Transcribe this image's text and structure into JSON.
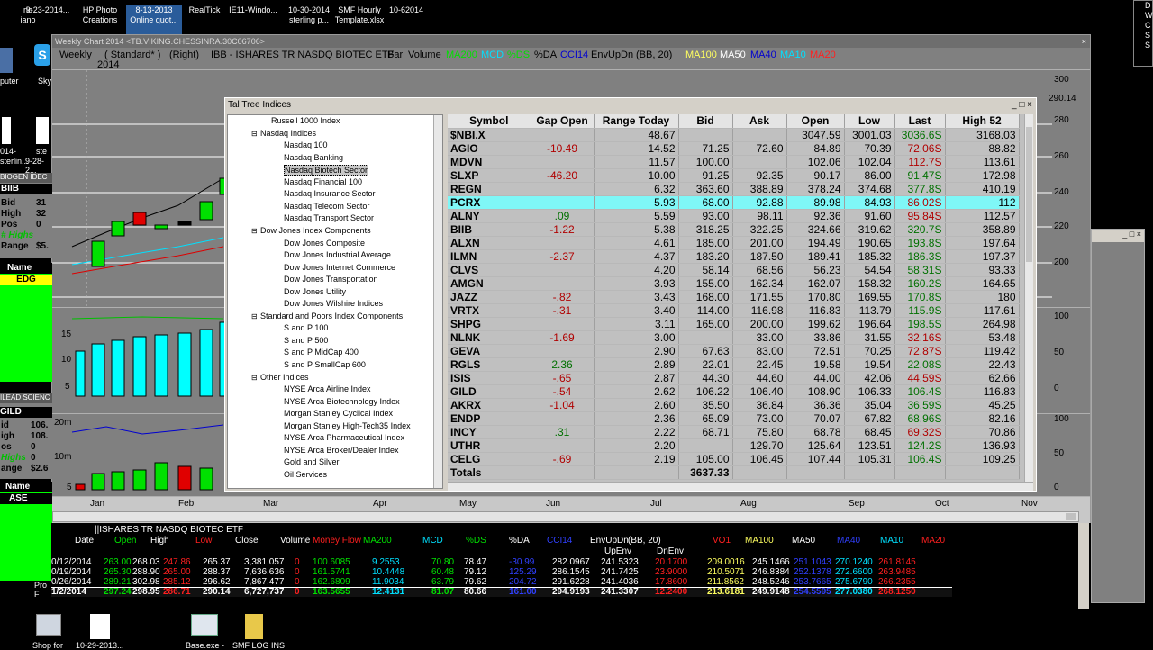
{
  "desktop_icons": [
    {
      "label1": "rio",
      "label2": "iano"
    },
    {
      "label1": "9-23-2014...",
      "label2": ""
    },
    {
      "label1": "HP Photo",
      "label2": "Creations"
    },
    {
      "label1": "8-13-2013",
      "label2": "Online quot..."
    },
    {
      "label1": "RealTick",
      "label2": ""
    },
    {
      "label1": "IE11-Windo...",
      "label2": ""
    },
    {
      "label1": "10-30-2014",
      "label2": "sterling p..."
    },
    {
      "label1": "SMF Hourly",
      "label2": "Template.xlsx"
    },
    {
      "label1": "10-62014",
      "label2": ""
    }
  ],
  "bottom_icons": [
    "Shop for",
    "10-29-2013...",
    "Base.exe -",
    "SMF LOG INS"
  ],
  "left_icons": [
    "puter",
    "Sky",
    "014-",
    "sterlin...",
    "ste",
    "9-28-2..."
  ],
  "chart_window": {
    "title": "Weekly Chart 2014",
    "title_path": "<TB.VIKING.CHESSINRA.30C06706>",
    "header": {
      "period": "Weekly",
      "style": "( Standard* )",
      "year": "2014",
      "side": "(Right)",
      "symbol": "IBB - ISHARES TR NASDQ BIOTEC ETF",
      "type": "Bar",
      "volume": "Volume",
      "ind1": "MA200",
      "ind2": "MCD",
      "ind3": "%DS",
      "ind4": "%DA",
      "ind5": "CCI14",
      "ind6": "EnvUpDn",
      "ind7": "(BB, 20)",
      "ind8": "MA100",
      "ind9": "MA50",
      "ind10": "MA40",
      "ind11": "MA10",
      "ind12": "MA20"
    },
    "price_axis": [
      "300",
      "290.14",
      "280",
      "260",
      "240",
      "220",
      "200"
    ],
    "vol_axis_left": [
      "15",
      "10",
      "5"
    ],
    "mcd_axis_left": [
      "20m",
      "10m",
      "5"
    ],
    "mid_axis": [
      "100",
      "50",
      "0"
    ],
    "bot_axis": [
      "100",
      "50",
      "0"
    ],
    "months": [
      "Jan",
      "Feb",
      "Mar",
      "Apr",
      "May",
      "Jun",
      "Jul",
      "Aug",
      "Sep",
      "Oct",
      "Nov"
    ],
    "left_panels": {
      "biib_label": "BIOGEN IDEC",
      "biib_sym": "BIIB",
      "bid": "Bid",
      "high": "High",
      "pos": "Pos",
      "highs": "# Highs",
      "range": "Range",
      "val1": "31",
      "val2": "32",
      "val3": "0",
      "val4": "$5.",
      "name1": "Name",
      "edg": "EDG",
      "gild_label": "ILEAD SCIENC",
      "gild_sym": "GILD",
      "id": "id",
      "igh": "igh",
      "os": "os",
      "highs2": "Highs",
      "range2": "ange",
      "gv1": "106.",
      "gv2": "108.",
      "gv3": "0",
      "gv4": "0",
      "gv5": "$2.6",
      "name2": "Name",
      "ase": "ASE",
      "pro": "Pro F"
    }
  },
  "tal": {
    "title": "Tal Tree Indices",
    "tree": [
      {
        "t": "Russell 1000 Index",
        "lvl": 1
      },
      {
        "t": "Nasdaq Indices",
        "lvl": 0
      },
      {
        "t": "Nasdaq 100",
        "lvl": 2
      },
      {
        "t": "Nasdaq Banking",
        "lvl": 2
      },
      {
        "t": "Nasdaq Biotech Sector",
        "lvl": 2
      },
      {
        "t": "Nasdaq Financial 100",
        "lvl": 2
      },
      {
        "t": "Nasdaq Insurance Sector",
        "lvl": 2
      },
      {
        "t": "Nasdaq Telecom Sector",
        "lvl": 2
      },
      {
        "t": "Nasdaq Transport Sector",
        "lvl": 2
      },
      {
        "t": "Dow Jones Index Components",
        "lvl": 0
      },
      {
        "t": "Dow Jones Composite",
        "lvl": 2
      },
      {
        "t": "Dow Jones Industrial Average",
        "lvl": 2
      },
      {
        "t": "Dow Jones Internet Commerce",
        "lvl": 2
      },
      {
        "t": "Dow Jones Transportation",
        "lvl": 2
      },
      {
        "t": "Dow Jones Utility",
        "lvl": 2
      },
      {
        "t": "Dow Jones Wilshire Indices",
        "lvl": 2
      },
      {
        "t": "Standard and Poors Index Components",
        "lvl": 0
      },
      {
        "t": "S and P 100",
        "lvl": 2
      },
      {
        "t": "S and P 500",
        "lvl": 2
      },
      {
        "t": "S and P MidCap 400",
        "lvl": 2
      },
      {
        "t": "S and P SmallCap 600",
        "lvl": 2
      },
      {
        "t": "Other Indices",
        "lvl": 0
      },
      {
        "t": "NYSE Arca Airline Index",
        "lvl": 2
      },
      {
        "t": "NYSE Arca Biotechnology Index",
        "lvl": 2
      },
      {
        "t": "Morgan Stanley Cyclical Index",
        "lvl": 2
      },
      {
        "t": "Morgan Stanley High-Tech35 Index",
        "lvl": 2
      },
      {
        "t": "NYSE Arca Pharmaceutical Index",
        "lvl": 2
      },
      {
        "t": "NYSE Arca Broker/Dealer Index",
        "lvl": 2
      },
      {
        "t": "Gold and Silver",
        "lvl": 2
      },
      {
        "t": "Oil Services",
        "lvl": 2
      }
    ],
    "columns": [
      "Symbol",
      "Gap Open",
      "Range Today",
      "Bid",
      "Ask",
      "Open",
      "Low",
      "Last",
      "High 52"
    ],
    "rows": [
      [
        "$NBI.X",
        "",
        "48.67",
        "",
        "",
        "3047.59",
        "3001.03",
        "3036.6S",
        "3168.03"
      ],
      [
        "AGIO",
        "-10.49",
        "14.52",
        "71.25",
        "72.60",
        "84.89",
        "70.39",
        "72.06S",
        "88.82"
      ],
      [
        "MDVN",
        "",
        "11.57",
        "100.00",
        "",
        "102.06",
        "102.04",
        "112.7S",
        "113.61"
      ],
      [
        "SLXP",
        "-46.20",
        "10.00",
        "91.25",
        "92.35",
        "90.17",
        "86.00",
        "91.47S",
        "172.98"
      ],
      [
        "REGN",
        "",
        "6.32",
        "363.60",
        "388.89",
        "378.24",
        "374.68",
        "377.8S",
        "410.19"
      ],
      [
        "PCRX",
        "",
        "5.93",
        "68.00",
        "92.88",
        "89.98",
        "84.93",
        "86.02S",
        "112"
      ],
      [
        "ALNY",
        ".09",
        "5.59",
        "93.00",
        "98.11",
        "92.36",
        "91.60",
        "95.84S",
        "112.57"
      ],
      [
        "BIIB",
        "-1.22",
        "5.38",
        "318.25",
        "322.25",
        "324.66",
        "319.62",
        "320.7S",
        "358.89"
      ],
      [
        "ALXN",
        "",
        "4.61",
        "185.00",
        "201.00",
        "194.49",
        "190.65",
        "193.8S",
        "197.64"
      ],
      [
        "ILMN",
        "-2.37",
        "4.37",
        "183.20",
        "187.50",
        "189.41",
        "185.32",
        "186.3S",
        "197.37"
      ],
      [
        "CLVS",
        "",
        "4.20",
        "58.14",
        "68.56",
        "56.23",
        "54.54",
        "58.31S",
        "93.33"
      ],
      [
        "AMGN",
        "",
        "3.93",
        "155.00",
        "162.34",
        "162.07",
        "158.32",
        "160.2S",
        "164.65"
      ],
      [
        "JAZZ",
        "-.82",
        "3.43",
        "168.00",
        "171.55",
        "170.80",
        "169.55",
        "170.8S",
        "180"
      ],
      [
        "VRTX",
        "-.31",
        "3.40",
        "114.00",
        "116.98",
        "116.83",
        "113.79",
        "115.9S",
        "117.61"
      ],
      [
        "SHPG",
        "",
        "3.11",
        "165.00",
        "200.00",
        "199.62",
        "196.64",
        "198.5S",
        "264.98"
      ],
      [
        "NLNK",
        "-1.69",
        "3.00",
        "",
        "33.00",
        "33.86",
        "31.55",
        "32.16S",
        "53.48"
      ],
      [
        "GEVA",
        "",
        "2.90",
        "67.63",
        "83.00",
        "72.51",
        "70.25",
        "72.87S",
        "119.42"
      ],
      [
        "RGLS",
        "2.36",
        "2.89",
        "22.01",
        "22.45",
        "19.58",
        "19.54",
        "22.08S",
        "22.43"
      ],
      [
        "ISIS",
        "-.65",
        "2.87",
        "44.30",
        "44.60",
        "44.00",
        "42.06",
        "44.59S",
        "62.66"
      ],
      [
        "GILD",
        "-.54",
        "2.62",
        "106.22",
        "106.40",
        "108.90",
        "106.33",
        "106.4S",
        "116.83"
      ],
      [
        "AKRX",
        "-1.04",
        "2.60",
        "35.50",
        "36.84",
        "36.36",
        "35.04",
        "36.59S",
        "45.25"
      ],
      [
        "ENDP",
        "",
        "2.36",
        "65.09",
        "73.00",
        "70.07",
        "67.82",
        "68.96S",
        "82.16"
      ],
      [
        "INCY",
        ".31",
        "2.22",
        "68.71",
        "75.80",
        "68.78",
        "68.45",
        "69.32S",
        "70.86"
      ],
      [
        "UTHR",
        "",
        "2.20",
        "",
        "129.70",
        "125.64",
        "123.51",
        "124.2S",
        "136.93"
      ],
      [
        "CELG",
        "-.69",
        "2.19",
        "105.00",
        "106.45",
        "107.44",
        "105.31",
        "106.4S",
        "109.25"
      ],
      [
        "Totals",
        "",
        "",
        "3637.33",
        "",
        "",
        "",
        "",
        ""
      ]
    ],
    "last_colors": [
      "g",
      "r",
      "r",
      "g",
      "g",
      "r",
      "r",
      "g",
      "g",
      "g",
      "g",
      "g",
      "g",
      "g",
      "g",
      "r",
      "r",
      "g",
      "r",
      "g",
      "g",
      "g",
      "r",
      "g",
      "g",
      ""
    ],
    "highlight_row": 5
  },
  "data_window": {
    "title": "ISHARES TR NASDQ BIOTEC ETF",
    "headers": [
      "Date",
      "Open",
      "High",
      "Low",
      "Close",
      "Volume",
      "Money Flow",
      "MA200",
      "MCD",
      "%DS",
      "%DA",
      "CCI14",
      "EnvUpDn",
      "(BB, 20)",
      "VO1",
      "MA100",
      "MA50",
      "MA40",
      "MA10",
      "MA20"
    ],
    "sub": [
      "UpEnv",
      "DnEnv"
    ],
    "rows": [
      [
        "0/12/2014",
        "263.00",
        "268.03",
        "247.86",
        "265.37",
        "3,381,057",
        "0",
        "100.6085",
        "9.2553",
        "70.80",
        "78.47",
        "-30.99",
        "282.0967",
        "241.5323",
        "20.1700",
        "209.0016",
        "245.1466",
        "251.1043",
        "270.1240",
        "261.8145"
      ],
      [
        "0/19/2014",
        "265.30",
        "288.90",
        "265.00",
        "288.37",
        "7,636,636",
        "0",
        "161.5741",
        "10.4448",
        "60.48",
        "79.12",
        "125.29",
        "286.1545",
        "241.7425",
        "23.9000",
        "210.5071",
        "246.8384",
        "252.1378",
        "272.6600",
        "263.9485"
      ],
      [
        "0/26/2014",
        "289.21",
        "302.98",
        "285.12",
        "296.62",
        "7,867,477",
        "0",
        "162.6809",
        "11.9034",
        "63.79",
        "79.62",
        "204.72",
        "291.6228",
        "241.4036",
        "17.8600",
        "211.8562",
        "248.5246",
        "253.7665",
        "275.6790",
        "266.2355"
      ],
      [
        "1/2/2014",
        "297.24",
        "298.95",
        "286.71",
        "290.14",
        "6,727,737",
        "0",
        "163.5655",
        "12.4131",
        "81.07",
        "80.66",
        "161.00",
        "294.9193",
        "241.3307",
        "12.2400",
        "213.6181",
        "249.9148",
        "254.5595",
        "277.0380",
        "268.1250"
      ]
    ]
  },
  "right_win": {
    "t1": "D",
    "t2": "W",
    "t3": "C",
    "t4": "S",
    "t5": "S"
  }
}
